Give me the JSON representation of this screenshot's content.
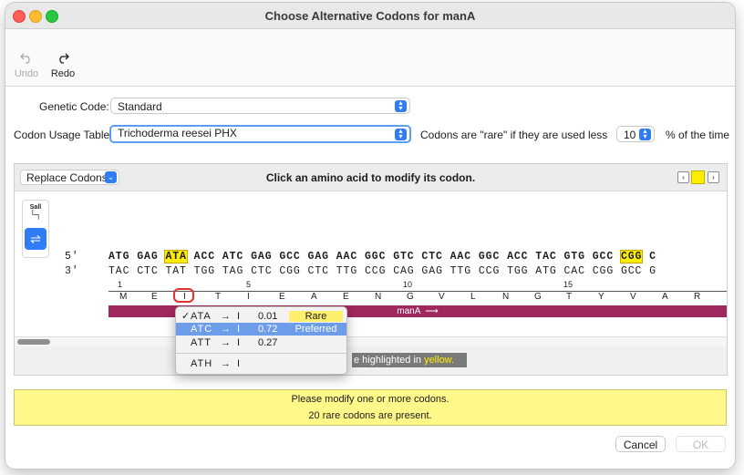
{
  "window": {
    "title": "Choose Alternative Codons for manA"
  },
  "toolbar": {
    "undo_label": "Undo",
    "redo_label": "Redo"
  },
  "form": {
    "genetic_code_label": "Genetic Code:",
    "genetic_code_value": "Standard",
    "codon_usage_label": "Codon Usage Table:",
    "codon_usage_value": "Trichoderma reesei PHX",
    "rare_prefix": "Codons are \"rare\" if they are used less thai",
    "rare_threshold": "10",
    "rare_suffix": "% of the time"
  },
  "panel": {
    "replace_label": "Replace Codons",
    "instruction": "Click an amino acid to modify its codon.",
    "palette_label": "Sall",
    "strand_top_label": "5'",
    "strand_bottom_label": "3'",
    "top_codons": [
      "ATG",
      "GAG",
      "ATA",
      "ACC",
      "ATC",
      "GAG",
      "GCC",
      "GAG",
      "AAC",
      "GGC",
      "GTC",
      "CTC",
      "AAC",
      "GGC",
      "ACC",
      "TAC",
      "GTG",
      "GCC",
      "CGG",
      "C"
    ],
    "bottom_codons": [
      "TAC",
      "CTC",
      "TAT",
      "TGG",
      "TAG",
      "CTC",
      "CGG",
      "CTC",
      "TTG",
      "CCG",
      "CAG",
      "GAG",
      "TTG",
      "CCG",
      "TGG",
      "ATG",
      "CAC",
      "CGG",
      "GCC",
      "G"
    ],
    "highlighted_codons": [
      2,
      18
    ],
    "ruler_ticks": [
      "1",
      "5",
      "10",
      "15"
    ],
    "amino_acids": [
      "M",
      "E",
      "I",
      "T",
      "I",
      "E",
      "A",
      "E",
      "N",
      "G",
      "V",
      "L",
      "N",
      "G",
      "T",
      "Y",
      "V",
      "A",
      "R"
    ],
    "feature_label": "manA",
    "status_text_prefix": "e highlighted in ",
    "status_text_highlight": "yellow."
  },
  "popup": {
    "rows": [
      {
        "check": "✓",
        "codon": "ATA",
        "arrow": "→",
        "aa": "I",
        "freq": "0.01",
        "tag": "Rare"
      },
      {
        "check": "",
        "codon": "ATC",
        "arrow": "→",
        "aa": "I",
        "freq": "0.72",
        "tag": "Preferred"
      },
      {
        "check": "",
        "codon": "ATT",
        "arrow": "→",
        "aa": "I",
        "freq": "0.27",
        "tag": ""
      },
      {
        "check": "",
        "codon": "ATH",
        "arrow": "→",
        "aa": "I",
        "freq": "",
        "tag": ""
      }
    ]
  },
  "message": {
    "line1": "Please modify one or more codons.",
    "line2": "20 rare codons are present."
  },
  "buttons": {
    "cancel": "Cancel",
    "ok": "OK"
  },
  "colors": {
    "highlight": "#ffee00",
    "feature": "#a1285f",
    "accent": "#2f7cf6",
    "selection": "#6d9ce8",
    "message_bg": "#fff98a"
  }
}
